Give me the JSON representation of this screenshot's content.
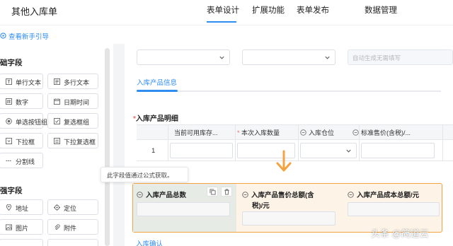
{
  "header": {
    "form_name": "其他入库单",
    "tabs": [
      {
        "label": "表单设计",
        "active": true
      },
      {
        "label": "扩展功能",
        "active": false
      },
      {
        "label": "表单发布",
        "active": false
      },
      {
        "label": "数据管理",
        "active": false
      }
    ]
  },
  "guide": {
    "label": "查看新手引导"
  },
  "sidebar": {
    "basic_section": "础字段",
    "basic_fields": [
      {
        "label": "单行文本",
        "icon": "text-line-icon"
      },
      {
        "label": "多行文本",
        "icon": "text-multi-icon"
      },
      {
        "label": "数字",
        "icon": "number-icon"
      },
      {
        "label": "日期时间",
        "icon": "calendar-icon"
      },
      {
        "label": "单选按钮组",
        "icon": "radio-icon"
      },
      {
        "label": "复选框组",
        "icon": "checkbox-icon"
      },
      {
        "label": "下拉框",
        "icon": "dropdown-icon"
      },
      {
        "label": "下拉复选框",
        "icon": "dropdown-multi-icon"
      },
      {
        "label": "分割线",
        "icon": "divider-icon"
      }
    ],
    "enhanced_section": "强字段",
    "enhanced_fields": [
      {
        "label": "地址",
        "icon": "address-icon"
      },
      {
        "label": "定位",
        "icon": "location-icon"
      },
      {
        "label": "图片",
        "icon": "image-icon"
      },
      {
        "label": "附件",
        "icon": "attachment-icon"
      }
    ]
  },
  "tooltip": {
    "text": "此字段值通过公式获取。"
  },
  "form": {
    "auto_placeholder": "自动生成无需填写",
    "sub_tab": "入库产品信息",
    "detail_title": "入库产品明细",
    "required_mark": "*",
    "table": {
      "columns": [
        {
          "label": "当前可用库存...",
          "required": false,
          "linked": false
        },
        {
          "label": "本次入库数量",
          "required": true,
          "linked": false
        },
        {
          "label": "入库仓位",
          "required": false,
          "linked": true
        },
        {
          "label": "标准售价(含税)/...",
          "required": false,
          "linked": true
        }
      ],
      "rows": [
        {
          "num": "1"
        }
      ]
    },
    "calc_fields": [
      {
        "label": "入库产品总数",
        "selected": true
      },
      {
        "label": "入库产品售价总额(含",
        "label2": "税)/元",
        "selected": false
      },
      {
        "label": "入库产品成本总额/元",
        "selected": false
      }
    ],
    "confirm_label": "入库确认"
  },
  "watermark": "头条 @简道云",
  "colors": {
    "accent": "#2f8cf0",
    "highlight_border": "#f4a340",
    "required": "#f56c6c"
  }
}
